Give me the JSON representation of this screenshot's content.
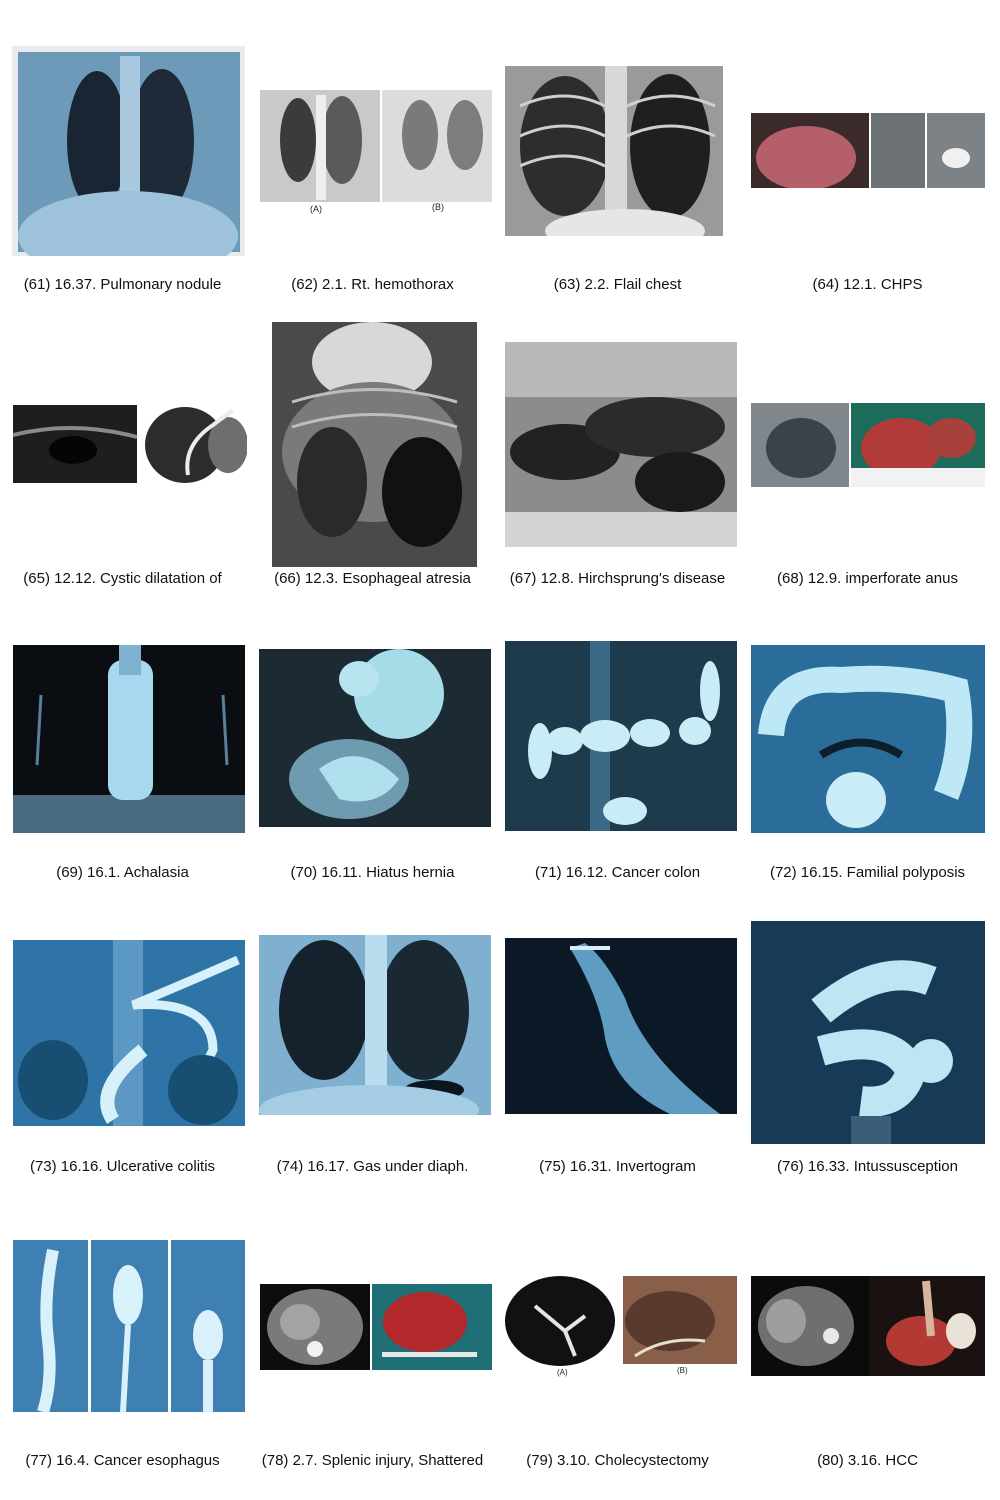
{
  "figures": [
    {
      "caption": "(61) 16.37. Pulmonary nodule",
      "subject": "chest x-ray"
    },
    {
      "caption": "(62) 2.1. Rt. hemothorax",
      "subject": "chest x-ray pair",
      "sub_labels": [
        "(A)",
        "(B)"
      ]
    },
    {
      "caption": "(63) 2.2. Flail chest",
      "subject": "chest x-ray"
    },
    {
      "caption": "(64) 12.1. CHPS",
      "subject": "clinical photo and contrast films"
    },
    {
      "caption": "(65) 12.12. Cystic dilatation of",
      "subject": "ultrasound and cholangiogram"
    },
    {
      "caption": "(66) 12.3. Esophageal atresia",
      "subject": "infant x-ray"
    },
    {
      "caption": "(67) 12.8. Hirchsprung's disease",
      "subject": "abdominal x-ray"
    },
    {
      "caption": "(68) 12.9. imperforate anus",
      "subject": "x-ray and operative photo"
    },
    {
      "caption": "(69) 16.1. Achalasia",
      "subject": "barium swallow"
    },
    {
      "caption": "(70) 16.11. Hiatus hernia",
      "subject": "barium study"
    },
    {
      "caption": "(71) 16.12. Cancer colon",
      "subject": "barium enema"
    },
    {
      "caption": "(72) 16.15. Familial polyposis",
      "subject": "barium enema"
    },
    {
      "caption": "(73) 16.16. Ulcerative colitis",
      "subject": "barium enema"
    },
    {
      "caption": "(74) 16.17. Gas under diaph.",
      "subject": "chest x-ray"
    },
    {
      "caption": "(75) 16.31. Invertogram",
      "subject": "lateral x-ray"
    },
    {
      "caption": "(76) 16.33. Intussusception",
      "subject": "barium enema"
    },
    {
      "caption": "(77) 16.4. Cancer esophagus",
      "subject": "barium swallow series"
    },
    {
      "caption": "(78) 2.7. Splenic injury, Shattered",
      "subject": "CT and operative photo"
    },
    {
      "caption": "(79) 3.10. Cholecystectomy",
      "subject": "cholangiogram and clinical photo",
      "sub_labels": [
        "(A)",
        "(B)"
      ]
    },
    {
      "caption": "(80) 3.16. HCC",
      "subject": "CT and operative photo"
    }
  ]
}
